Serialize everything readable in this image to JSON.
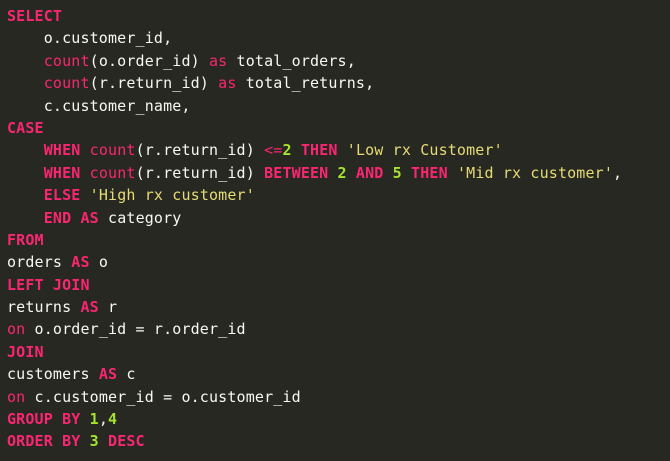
{
  "editor": {
    "language": "SQL",
    "theme": "monokai",
    "colors": {
      "background": "#272822",
      "keyword": "#f92672",
      "number": "#a6e22e",
      "string": "#e6db74",
      "text": "#f8f8f2"
    },
    "lines": [
      [
        {
          "t": "kw",
          "v": "SELECT"
        }
      ],
      [
        {
          "t": "id",
          "v": "    o.customer_id,"
        }
      ],
      [
        {
          "t": "id",
          "v": "    "
        },
        {
          "t": "fn",
          "v": "count"
        },
        {
          "t": "id",
          "v": "(o.order_id) "
        },
        {
          "t": "fn",
          "v": "as"
        },
        {
          "t": "id",
          "v": " total_orders,"
        }
      ],
      [
        {
          "t": "id",
          "v": "    "
        },
        {
          "t": "fn",
          "v": "count"
        },
        {
          "t": "id",
          "v": "(r.return_id) "
        },
        {
          "t": "fn",
          "v": "as"
        },
        {
          "t": "id",
          "v": " total_returns,"
        }
      ],
      [
        {
          "t": "id",
          "v": "    c.customer_name,"
        }
      ],
      [
        {
          "t": "kw",
          "v": "CASE"
        }
      ],
      [
        {
          "t": "id",
          "v": "    "
        },
        {
          "t": "kw",
          "v": "WHEN"
        },
        {
          "t": "id",
          "v": " "
        },
        {
          "t": "fn",
          "v": "count"
        },
        {
          "t": "id",
          "v": "(r.return_id) "
        },
        {
          "t": "op",
          "v": "<="
        },
        {
          "t": "num",
          "v": "2"
        },
        {
          "t": "id",
          "v": " "
        },
        {
          "t": "kw",
          "v": "THEN"
        },
        {
          "t": "id",
          "v": " "
        },
        {
          "t": "str",
          "v": "'Low rx Customer'"
        }
      ],
      [
        {
          "t": "id",
          "v": "    "
        },
        {
          "t": "kw",
          "v": "WHEN"
        },
        {
          "t": "id",
          "v": " "
        },
        {
          "t": "fn",
          "v": "count"
        },
        {
          "t": "id",
          "v": "(r.return_id) "
        },
        {
          "t": "kw",
          "v": "BETWEEN"
        },
        {
          "t": "id",
          "v": " "
        },
        {
          "t": "num",
          "v": "2"
        },
        {
          "t": "id",
          "v": " "
        },
        {
          "t": "kw",
          "v": "AND"
        },
        {
          "t": "id",
          "v": " "
        },
        {
          "t": "num",
          "v": "5"
        },
        {
          "t": "id",
          "v": " "
        },
        {
          "t": "kw",
          "v": "THEN"
        },
        {
          "t": "id",
          "v": " "
        },
        {
          "t": "str",
          "v": "'Mid rx customer'"
        },
        {
          "t": "id",
          "v": ","
        }
      ],
      [
        {
          "t": "id",
          "v": "    "
        },
        {
          "t": "kw",
          "v": "ELSE"
        },
        {
          "t": "id",
          "v": " "
        },
        {
          "t": "str",
          "v": "'High rx customer'"
        }
      ],
      [
        {
          "t": "id",
          "v": "    "
        },
        {
          "t": "kw",
          "v": "END"
        },
        {
          "t": "id",
          "v": " "
        },
        {
          "t": "kw",
          "v": "AS"
        },
        {
          "t": "id",
          "v": " category"
        }
      ],
      [
        {
          "t": "kw",
          "v": "FROM"
        }
      ],
      [
        {
          "t": "id",
          "v": "orders "
        },
        {
          "t": "kw",
          "v": "AS"
        },
        {
          "t": "id",
          "v": " o"
        }
      ],
      [
        {
          "t": "kw",
          "v": "LEFT JOIN"
        }
      ],
      [
        {
          "t": "id",
          "v": "returns "
        },
        {
          "t": "kw",
          "v": "AS"
        },
        {
          "t": "id",
          "v": " r"
        }
      ],
      [
        {
          "t": "fn",
          "v": "on"
        },
        {
          "t": "id",
          "v": " o.order_id = r.order_id"
        }
      ],
      [
        {
          "t": "kw",
          "v": "JOIN"
        }
      ],
      [
        {
          "t": "id",
          "v": "customers "
        },
        {
          "t": "kw",
          "v": "AS"
        },
        {
          "t": "id",
          "v": " c"
        }
      ],
      [
        {
          "t": "fn",
          "v": "on"
        },
        {
          "t": "id",
          "v": " c.customer_id = o.customer_id"
        }
      ],
      [
        {
          "t": "kw",
          "v": "GROUP BY"
        },
        {
          "t": "id",
          "v": " "
        },
        {
          "t": "num",
          "v": "1"
        },
        {
          "t": "id",
          "v": ","
        },
        {
          "t": "num",
          "v": "4"
        }
      ],
      [
        {
          "t": "kw",
          "v": "ORDER BY"
        },
        {
          "t": "id",
          "v": " "
        },
        {
          "t": "num",
          "v": "3"
        },
        {
          "t": "id",
          "v": " "
        },
        {
          "t": "kw",
          "v": "DESC"
        }
      ]
    ]
  }
}
